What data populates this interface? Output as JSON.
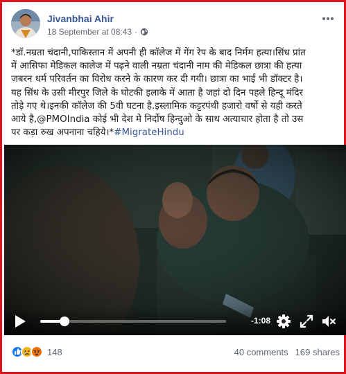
{
  "post": {
    "author": "Jivanbhai Ahir",
    "timestamp": "18 September at 08:43",
    "privacy_dot": "·",
    "text_lines": [
      "*डॉ.नम्रता चंदानी,पाकिस्तान में अपनी ही कॉलेज में गेंग रेप के बाद निर्मम हत्या।सिंध प्रांत",
      "में आसिफा मेडिकल कालेज में पढ़ने वाली नम्रता चंदानी नाम की मेडिकल छात्रा की हत्या",
      "जबरन धर्म परिवर्तन का विरोध करने के कारण कर दी गयी। छात्रा का भाई भी डॉक्टर है।",
      "यह सिंध के उसी मीरपुर जिले के घोटकी इलाके में आता है जहां दो दिन पहले हिन्दू मंदिर",
      "तोड़े गए थे।इनकी कॉलेज की 5वी घटना है.इस्लामिक कट्टरपंथी हजारो वर्षो से यही करते",
      "आये है,@PMOIndia कोई भी देश मे निर्दोष हिन्दुओ के साथ अत्याचार होता है तो उस"
    ],
    "last_line_text": "पर कड़ा रुख अपनाना चहिये।*",
    "hashtag": "#MigrateHindu"
  },
  "video": {
    "time_remaining": "-1:08",
    "progress": 0.13
  },
  "footer": {
    "reaction_count": "148",
    "comments": "40 comments",
    "shares": "169 shares"
  },
  "colors": {
    "frame_border": "#e0141e",
    "link": "#385898",
    "like_blue": "#1877f2"
  },
  "icons": [
    "more-options-icon",
    "globe-icon",
    "play-icon",
    "settings-icon",
    "fullscreen-icon",
    "volume-icon",
    "like-reaction-icon",
    "sad-reaction-icon",
    "angry-reaction-icon"
  ]
}
